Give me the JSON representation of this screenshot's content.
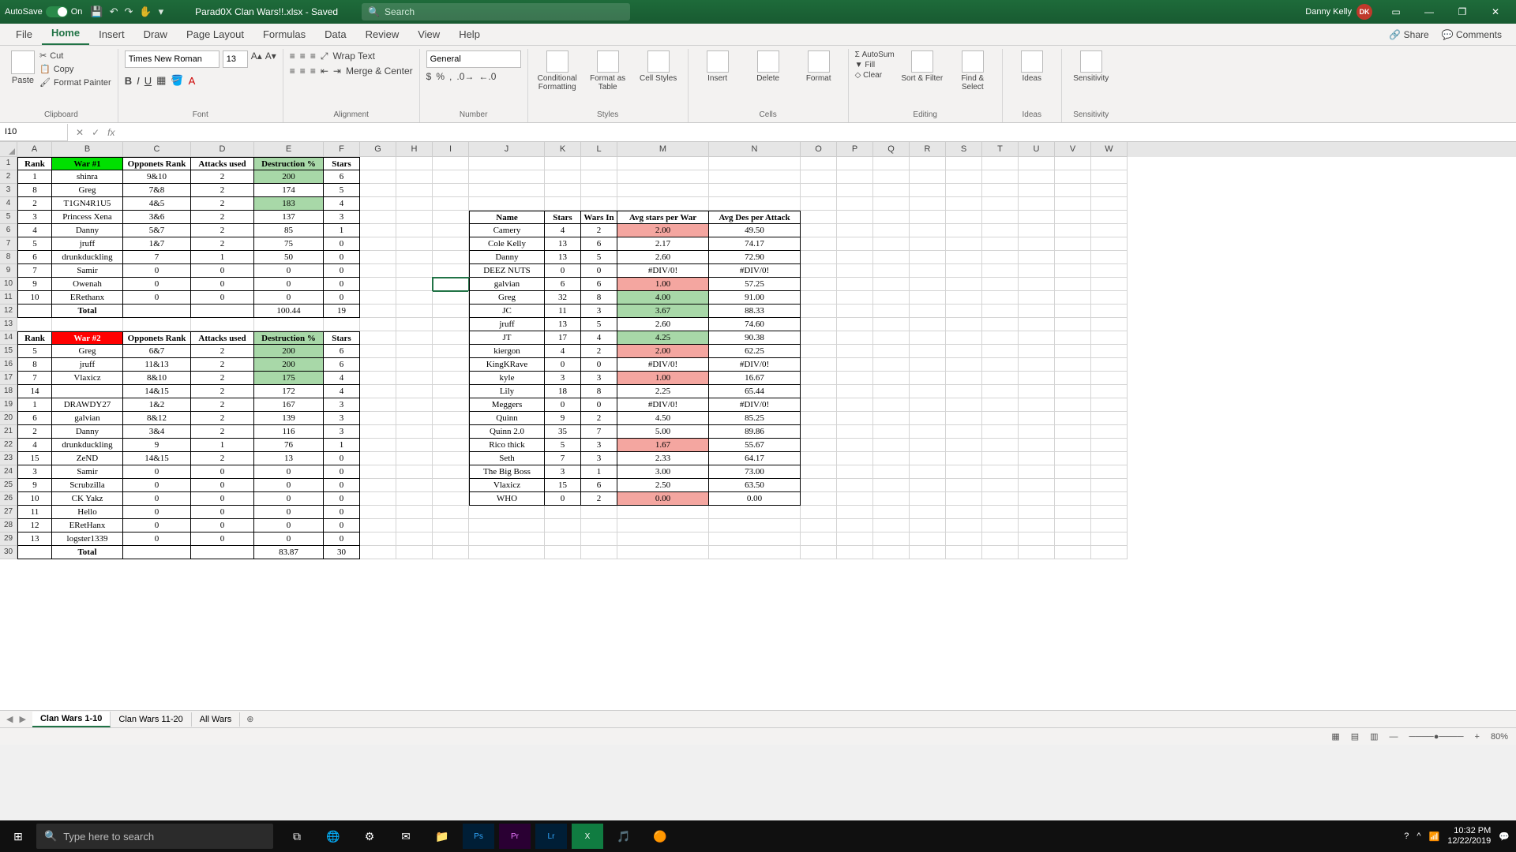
{
  "title": {
    "autosave": "AutoSave",
    "on": "On",
    "filename": "Parad0X Clan Wars!!.xlsx  -  Saved",
    "search_ph": "Search",
    "user": "Danny Kelly",
    "initials": "DK"
  },
  "ribtabs": [
    "File",
    "Home",
    "Insert",
    "Draw",
    "Page Layout",
    "Formulas",
    "Data",
    "Review",
    "View",
    "Help"
  ],
  "ribright": {
    "share": "Share",
    "comments": "Comments"
  },
  "clip": {
    "paste": "Paste",
    "cut": "Cut",
    "copy": "Copy",
    "fp": "Format Painter",
    "label": "Clipboard"
  },
  "font": {
    "name": "Times New Roman",
    "size": "13",
    "label": "Font"
  },
  "align": {
    "wrap": "Wrap Text",
    "merge": "Merge & Center",
    "label": "Alignment"
  },
  "number": {
    "fmt": "General",
    "label": "Number"
  },
  "styles": {
    "cf": "Conditional Formatting",
    "fat": "Format as Table",
    "cs": "Cell Styles",
    "label": "Styles"
  },
  "cells": {
    "ins": "Insert",
    "del": "Delete",
    "fmt": "Format",
    "label": "Cells"
  },
  "editing": {
    "as": "AutoSum",
    "fill": "Fill",
    "clear": "Clear",
    "sort": "Sort & Filter",
    "find": "Find & Select",
    "label": "Editing"
  },
  "ideas": {
    "btn": "Ideas",
    "label": "Ideas"
  },
  "sens": {
    "btn": "Sensitivity",
    "label": "Sensitivity"
  },
  "namebox": "I10",
  "cols": [
    "A",
    "B",
    "C",
    "D",
    "E",
    "F",
    "G",
    "H",
    "I",
    "J",
    "K",
    "L",
    "M",
    "N",
    "O",
    "P",
    "Q",
    "R",
    "S",
    "T",
    "U",
    "V",
    "W"
  ],
  "war1_hdr": {
    "a": "Rank",
    "b": "War #1",
    "c": "Opponets Rank",
    "d": "Attacks used",
    "e": "Destruction %",
    "f": "Stars"
  },
  "war1": [
    {
      "a": "1",
      "b": "shinra",
      "c": "9&10",
      "d": "2",
      "e": "200",
      "f": "6",
      "eg": true
    },
    {
      "a": "8",
      "b": "Greg",
      "c": "7&8",
      "d": "2",
      "e": "174",
      "f": "5",
      "eg": false
    },
    {
      "a": "2",
      "b": "T1GN4R1U5",
      "c": "4&5",
      "d": "2",
      "e": "183",
      "f": "4",
      "eg": true
    },
    {
      "a": "3",
      "b": "Princess Xena",
      "c": "3&6",
      "d": "2",
      "e": "137",
      "f": "3",
      "eg": false
    },
    {
      "a": "4",
      "b": "Danny",
      "c": "5&7",
      "d": "2",
      "e": "85",
      "f": "1",
      "eg": false
    },
    {
      "a": "5",
      "b": "jruff",
      "c": "1&7",
      "d": "2",
      "e": "75",
      "f": "0",
      "eg": false
    },
    {
      "a": "6",
      "b": "drunkduckling",
      "c": "7",
      "d": "1",
      "e": "50",
      "f": "0",
      "eg": false
    },
    {
      "a": "7",
      "b": "Samir",
      "c": "0",
      "d": "0",
      "e": "0",
      "f": "0",
      "eg": false
    },
    {
      "a": "9",
      "b": "Owenah",
      "c": "0",
      "d": "0",
      "e": "0",
      "f": "0",
      "eg": false
    },
    {
      "a": "10",
      "b": "ERethanx",
      "c": "0",
      "d": "0",
      "e": "0",
      "f": "0",
      "eg": false
    }
  ],
  "war1_total": {
    "b": "Total",
    "e": "100.44",
    "f": "19"
  },
  "war2_hdr": {
    "a": "Rank",
    "b": "War #2",
    "c": "Opponets Rank",
    "d": "Attacks used",
    "e": "Destruction %",
    "f": "Stars"
  },
  "war2": [
    {
      "a": "5",
      "b": "Greg",
      "c": "6&7",
      "d": "2",
      "e": "200",
      "f": "6",
      "eg": true
    },
    {
      "a": "8",
      "b": "jruff",
      "c": "11&13",
      "d": "2",
      "e": "200",
      "f": "6",
      "eg": true
    },
    {
      "a": "7",
      "b": "Vlaxicz",
      "c": "8&10",
      "d": "2",
      "e": "175",
      "f": "4",
      "eg": true
    },
    {
      "a": "14",
      "b": "",
      "c": "14&15",
      "d": "2",
      "e": "172",
      "f": "4",
      "eg": false
    },
    {
      "a": "1",
      "b": "DRAWDY27",
      "c": "1&2",
      "d": "2",
      "e": "167",
      "f": "3",
      "eg": false
    },
    {
      "a": "6",
      "b": "galvian",
      "c": "8&12",
      "d": "2",
      "e": "139",
      "f": "3",
      "eg": false
    },
    {
      "a": "2",
      "b": "Danny",
      "c": "3&4",
      "d": "2",
      "e": "116",
      "f": "3",
      "eg": false
    },
    {
      "a": "4",
      "b": "drunkduckling",
      "c": "9",
      "d": "1",
      "e": "76",
      "f": "1",
      "eg": false
    },
    {
      "a": "15",
      "b": "ZeND",
      "c": "14&15",
      "d": "2",
      "e": "13",
      "f": "0",
      "eg": false
    },
    {
      "a": "3",
      "b": "Samir",
      "c": "0",
      "d": "0",
      "e": "0",
      "f": "0",
      "eg": false
    },
    {
      "a": "9",
      "b": "Scrubzilla",
      "c": "0",
      "d": "0",
      "e": "0",
      "f": "0",
      "eg": false
    },
    {
      "a": "10",
      "b": "CK Yakz",
      "c": "0",
      "d": "0",
      "e": "0",
      "f": "0",
      "eg": false
    },
    {
      "a": "11",
      "b": "Hello",
      "c": "0",
      "d": "0",
      "e": "0",
      "f": "0",
      "eg": false
    },
    {
      "a": "12",
      "b": "ERetHanx",
      "c": "0",
      "d": "0",
      "e": "0",
      "f": "0",
      "eg": false
    },
    {
      "a": "13",
      "b": "logster1339",
      "c": "0",
      "d": "0",
      "e": "0",
      "f": "0",
      "eg": false
    }
  ],
  "war2_total": {
    "b": "Total",
    "e": "83.87",
    "f": "30"
  },
  "summary_hdr": {
    "j": "Name",
    "k": "Stars",
    "l": "Wars In",
    "m": "Avg stars per War",
    "n": "Avg Des per Attack"
  },
  "summary": [
    {
      "j": "Camery",
      "k": "4",
      "l": "2",
      "m": "2.00",
      "n": "49.50",
      "mc": "lred"
    },
    {
      "j": "Cole Kelly",
      "k": "13",
      "l": "6",
      "m": "2.17",
      "n": "74.17"
    },
    {
      "j": "Danny",
      "k": "13",
      "l": "5",
      "m": "2.60",
      "n": "72.90"
    },
    {
      "j": "DEEZ NUTS",
      "k": "0",
      "l": "0",
      "m": "#DIV/0!",
      "n": "#DIV/0!"
    },
    {
      "j": "galvian",
      "k": "6",
      "l": "6",
      "m": "1.00",
      "n": "57.25",
      "mc": "lred"
    },
    {
      "j": "Greg",
      "k": "32",
      "l": "8",
      "m": "4.00",
      "n": "91.00",
      "mc": "lgreen"
    },
    {
      "j": "JC",
      "k": "11",
      "l": "3",
      "m": "3.67",
      "n": "88.33",
      "mc": "lgreen"
    },
    {
      "j": "jruff",
      "k": "13",
      "l": "5",
      "m": "2.60",
      "n": "74.60"
    },
    {
      "j": "JT",
      "k": "17",
      "l": "4",
      "m": "4.25",
      "n": "90.38",
      "mc": "lgreen"
    },
    {
      "j": "kiergon",
      "k": "4",
      "l": "2",
      "m": "2.00",
      "n": "62.25",
      "mc": "lred"
    },
    {
      "j": "KingKRave",
      "k": "0",
      "l": "0",
      "m": "#DIV/0!",
      "n": "#DIV/0!"
    },
    {
      "j": "kyle",
      "k": "3",
      "l": "3",
      "m": "1.00",
      "n": "16.67",
      "mc": "lred"
    },
    {
      "j": "Lily",
      "k": "18",
      "l": "8",
      "m": "2.25",
      "n": "65.44"
    },
    {
      "j": "Meggers",
      "k": "0",
      "l": "0",
      "m": "#DIV/0!",
      "n": "#DIV/0!"
    },
    {
      "j": "Quinn",
      "k": "9",
      "l": "2",
      "m": "4.50",
      "n": "85.25"
    },
    {
      "j": "Quinn 2.0",
      "k": "35",
      "l": "7",
      "m": "5.00",
      "n": "89.86"
    },
    {
      "j": "Rico thick",
      "k": "5",
      "l": "3",
      "m": "1.67",
      "n": "55.67",
      "mc": "lred"
    },
    {
      "j": "Seth",
      "k": "7",
      "l": "3",
      "m": "2.33",
      "n": "64.17"
    },
    {
      "j": "The Big Boss",
      "k": "3",
      "l": "1",
      "m": "3.00",
      "n": "73.00"
    },
    {
      "j": "Vlaxicz",
      "k": "15",
      "l": "6",
      "m": "2.50",
      "n": "63.50"
    },
    {
      "j": "WHO",
      "k": "0",
      "l": "2",
      "m": "0.00",
      "n": "0.00",
      "mc": "lred"
    }
  ],
  "sheetnav": {
    "t1": "Clan Wars 1-10",
    "t2": "Clan Wars 11-20",
    "t3": "All Wars"
  },
  "zoom": "80%",
  "taskbar": {
    "search": "Type here to search",
    "time": "10:32 PM",
    "date": "12/22/2019"
  }
}
